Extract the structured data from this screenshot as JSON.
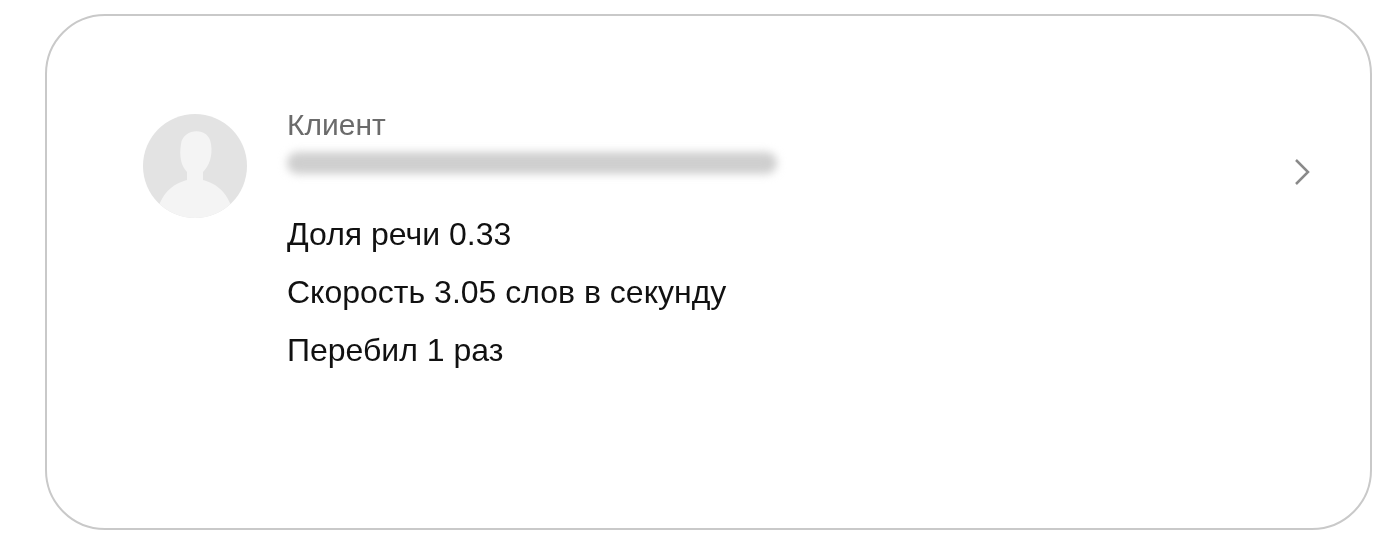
{
  "contact": {
    "role": "Клиент"
  },
  "stats": [
    "Доля речи 0.33",
    "Скорость 3.05 слов в секунду",
    "Перебил 1 раз"
  ]
}
